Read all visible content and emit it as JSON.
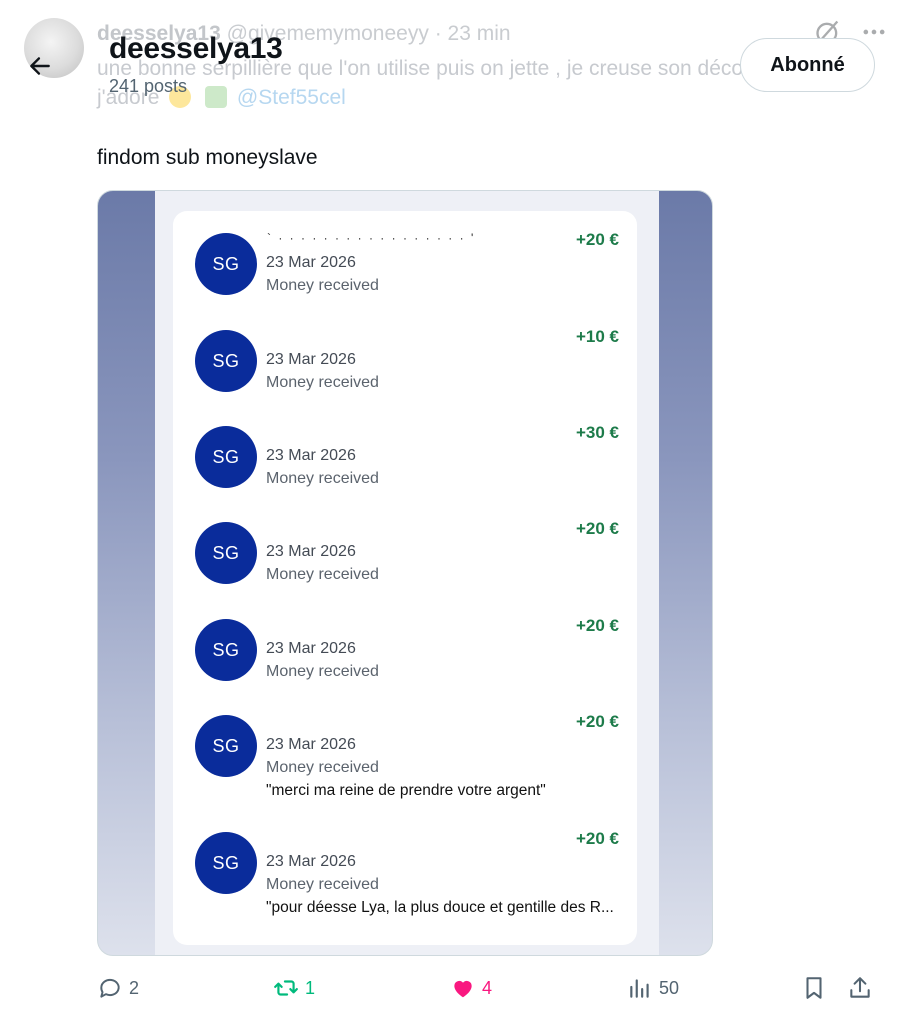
{
  "profile_header": {
    "name": "deesselya13",
    "posts_count": "241 posts",
    "follow_label": "Abonné"
  },
  "tweet": {
    "author_name": "deesselya13",
    "author_handle": "@givememymoneeyy",
    "separator": "·",
    "time": "23 min",
    "text_line1": "une bonne serpillière que l'on utilise puis on jette , je creuse son découvert",
    "text_line2_prefix": "j'adore",
    "mention": "@Stef55cel",
    "text_main": "findom sub moneyslave"
  },
  "transactions": [
    {
      "avatar": "SG",
      "redacted": "`  ·  ·  ·  ·  ·  ·  ·  ·  ·  ·  ·  ·  ·  ·  ·  ·  ·  '",
      "date": "23 Mar 2026",
      "status": "Money received",
      "note": "",
      "amount": "+20 €"
    },
    {
      "avatar": "SG",
      "redacted": "",
      "date": "23 Mar 2026",
      "status": "Money received",
      "note": "",
      "amount": "+10 €"
    },
    {
      "avatar": "SG",
      "redacted": "",
      "date": "23 Mar 2026",
      "status": "Money received",
      "note": "",
      "amount": "+30 €"
    },
    {
      "avatar": "SG",
      "redacted": "",
      "date": "23 Mar 2026",
      "status": "Money received",
      "note": "",
      "amount": "+20 €"
    },
    {
      "avatar": "SG",
      "redacted": "",
      "date": "23 Mar 2026",
      "status": "Money received",
      "note": "",
      "amount": "+20 €"
    },
    {
      "avatar": "SG",
      "redacted": "",
      "date": "23 Mar 2026",
      "status": "Money received",
      "note": "\"merci ma reine de prendre votre argent\"",
      "amount": "+20 €"
    },
    {
      "avatar": "SG",
      "redacted": "",
      "date": "23 Mar 2026",
      "status": "Money received",
      "note": "\"pour déesse Lya, la plus douce et gentille des R...",
      "amount": "+20 €"
    }
  ],
  "actions": {
    "replies": "2",
    "reposts": "1",
    "likes": "4",
    "views": "50"
  },
  "colors": {
    "accent_follow_border": "#cfd9de",
    "repost_green": "#00ba7c",
    "like_pink": "#f91880",
    "amount_green": "#1d7b4a",
    "bank_blue": "#0a2c9b"
  },
  "icons": {
    "back": "arrow-left-icon",
    "grok": "grok-icon",
    "more": "more-horizontal-icon",
    "reply": "reply-icon",
    "repost": "repost-icon",
    "like": "heart-icon",
    "views": "views-chart-icon",
    "bookmark": "bookmark-icon",
    "share": "share-icon"
  }
}
